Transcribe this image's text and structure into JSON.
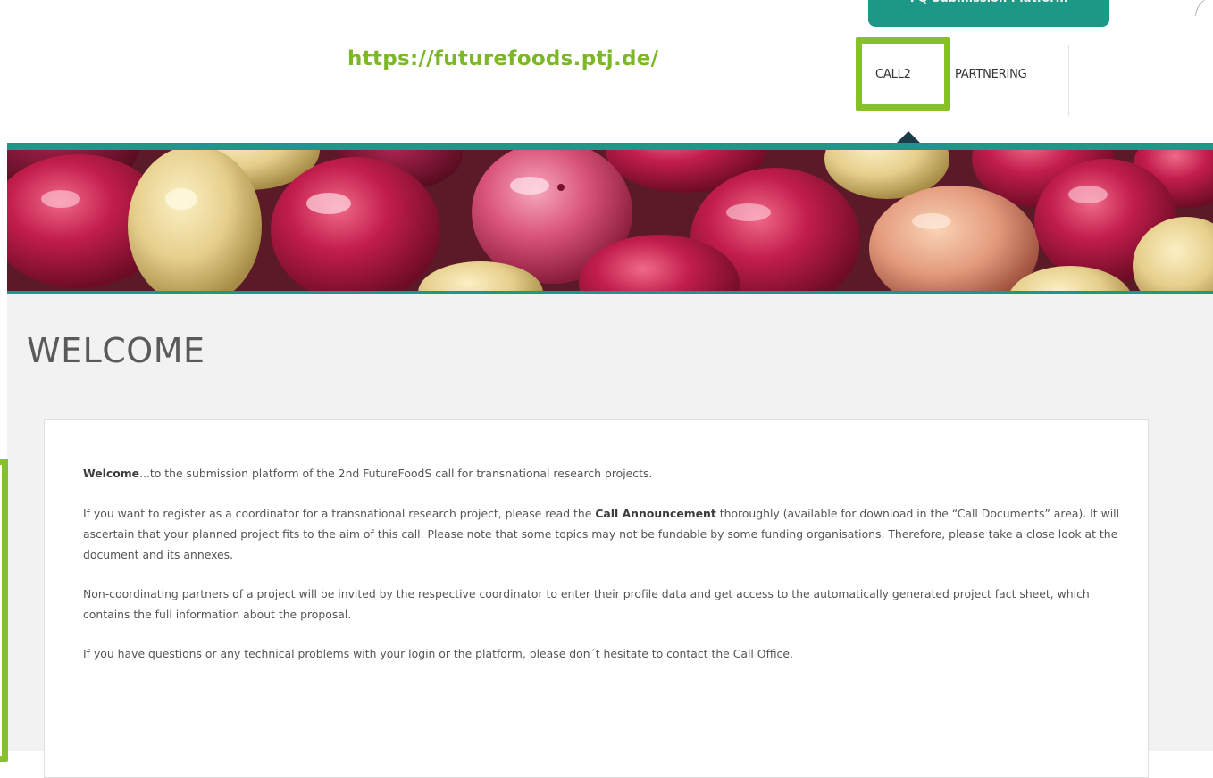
{
  "header": {
    "platform_badge": "FQ Submission Platform",
    "url_annotation": "https://futurefoods.ptj.de/",
    "nav": {
      "items": [
        {
          "label": "CALL2"
        },
        {
          "label": "PARTNERING"
        }
      ]
    }
  },
  "main": {
    "title": "WELCOME",
    "intro": {
      "bold": "Welcome",
      "text": "...to the submission platform of the 2nd FutureFoodS call for transnational research projects."
    },
    "para2": {
      "before": " If you want to register as a coordinator for a transnational research project, please read the ",
      "bold": "Call Announcement",
      "after": " thoroughly (available for download in the “Call Documents” area). It will ascertain that your planned project fits to the aim of this call. Please note that some topics may not be fundable by some funding organisations. Therefore, please take a close look at the document and its annexes."
    },
    "para3": "Non-coordinating partners of a project will be invited by the respective coordinator to enter their profile data and get access to the automatically generated project fact sheet, which contains the full information about the proposal.",
    "para4": "If you have questions or any technical problems with your login or the platform, please don´t hesitate to contact the Call Office."
  },
  "colors": {
    "accent_teal": "#1e9886",
    "annotation_green": "#86c12a",
    "nav_indicator": "#1b3d4a"
  }
}
